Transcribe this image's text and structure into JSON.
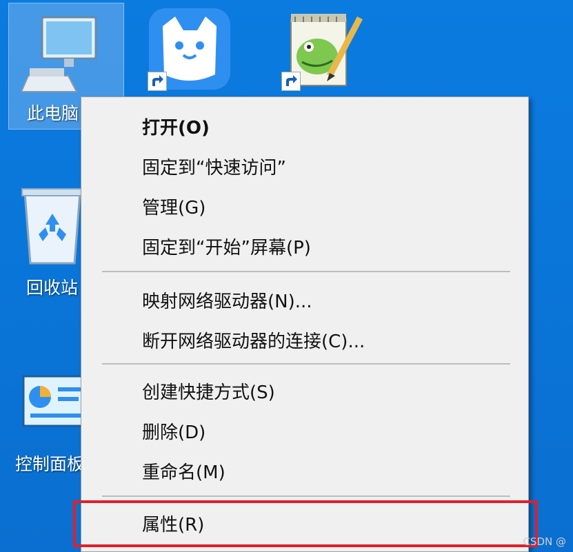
{
  "desktop": {
    "icons": [
      {
        "label": "此电脑",
        "icon": "this-pc-icon"
      },
      {
        "label": "",
        "icon": "cat-app-icon"
      },
      {
        "label": "",
        "icon": "notepad-plus-plus-icon"
      },
      {
        "label": "回收站",
        "icon": "recycle-bin-icon"
      },
      {
        "label": "控制面板",
        "icon": "control-panel-icon"
      }
    ]
  },
  "context_menu": {
    "items": [
      {
        "label": "打开(O)",
        "bold": true
      },
      {
        "label": "固定到“快速访问”"
      },
      {
        "label": "管理(G)"
      },
      {
        "label": "固定到“开始”屏幕(P)"
      },
      {
        "label": "映射网络驱动器(N)..."
      },
      {
        "label": "断开网络驱动器的连接(C)..."
      },
      {
        "label": "创建快捷方式(S)"
      },
      {
        "label": "删除(D)"
      },
      {
        "label": "重命名(M)"
      },
      {
        "label": "属性(R)"
      }
    ]
  },
  "highlight_color": "#e0202a",
  "watermark": "CSDN @"
}
